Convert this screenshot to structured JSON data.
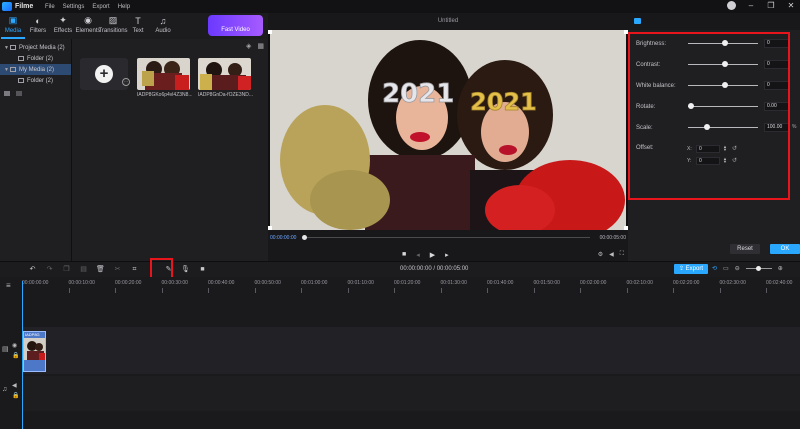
{
  "app": {
    "name": "Filme",
    "menu": [
      "File",
      "Settings",
      "Export",
      "Help"
    ]
  },
  "toolbar": {
    "items": [
      {
        "label": "Media",
        "icon": "media-icon",
        "active": true
      },
      {
        "label": "Filters",
        "icon": "filters-icon"
      },
      {
        "label": "Effects",
        "icon": "effects-icon"
      },
      {
        "label": "Elements",
        "icon": "elements-icon"
      },
      {
        "label": "Transitions",
        "icon": "transitions-icon"
      },
      {
        "label": "Text",
        "icon": "text-icon"
      },
      {
        "label": "Audio",
        "icon": "audio-icon"
      }
    ],
    "fast_video": "Fast Video"
  },
  "tree": {
    "items": [
      {
        "label": "Project Media (2)",
        "level": 0,
        "selected": false
      },
      {
        "label": "Folder (2)",
        "level": 1,
        "selected": false
      },
      {
        "label": "My Media (2)",
        "level": 0,
        "selected": true
      },
      {
        "label": "Folder (2)",
        "level": 1,
        "selected": false
      }
    ]
  },
  "media": {
    "thumbs": [
      {
        "caption": "IADP8GKo6p4vl4Z3N8..."
      },
      {
        "caption": "IADP8GnDa-fOZE3ND..."
      }
    ]
  },
  "preview": {
    "title": "Untitled",
    "timecode_current": "00:00:00:00",
    "timecode_total": "00:00:05:00",
    "photo_text": "2021"
  },
  "properties": {
    "rows": [
      {
        "label": "Brightness:",
        "value": "0",
        "knob": 0.5
      },
      {
        "label": "Contrast:",
        "value": "0",
        "knob": 0.5
      },
      {
        "label": "White balance:",
        "value": "0",
        "knob": 0.5
      },
      {
        "label": "Rotate:",
        "value": "0.00",
        "knob": 0.0
      },
      {
        "label": "Scale:",
        "value": "100.00",
        "knob": 0.25,
        "unit": "%"
      }
    ],
    "offset_label": "Offset:",
    "offset_x_label": "X:",
    "offset_y_label": "Y:",
    "offset_x": "0",
    "offset_y": "0",
    "reset_button": "Reset",
    "ok_button": "OK"
  },
  "timeline": {
    "timecode": "00:00:00:00 / 00:00:05:00",
    "export_button": "Export",
    "ruler": [
      "00:00:00:00",
      "00:00:10:00",
      "00:00:20:00",
      "00:00:30:00",
      "00:00:40:00",
      "00:00:50:00",
      "00:01:00:00",
      "00:01:10:00",
      "00:01:20:00",
      "00:01:30:00",
      "00:01:40:00",
      "00:01:50:00",
      "00:02:00:00",
      "00:02:10:00",
      "00:02:20:00",
      "00:02:30:00",
      "00:02:40:00"
    ],
    "clip_label": "IADP8G"
  },
  "colors": {
    "accent": "#2aa7ff",
    "highlight_box": "#e8161c",
    "fast_video": "#7b45ff"
  }
}
